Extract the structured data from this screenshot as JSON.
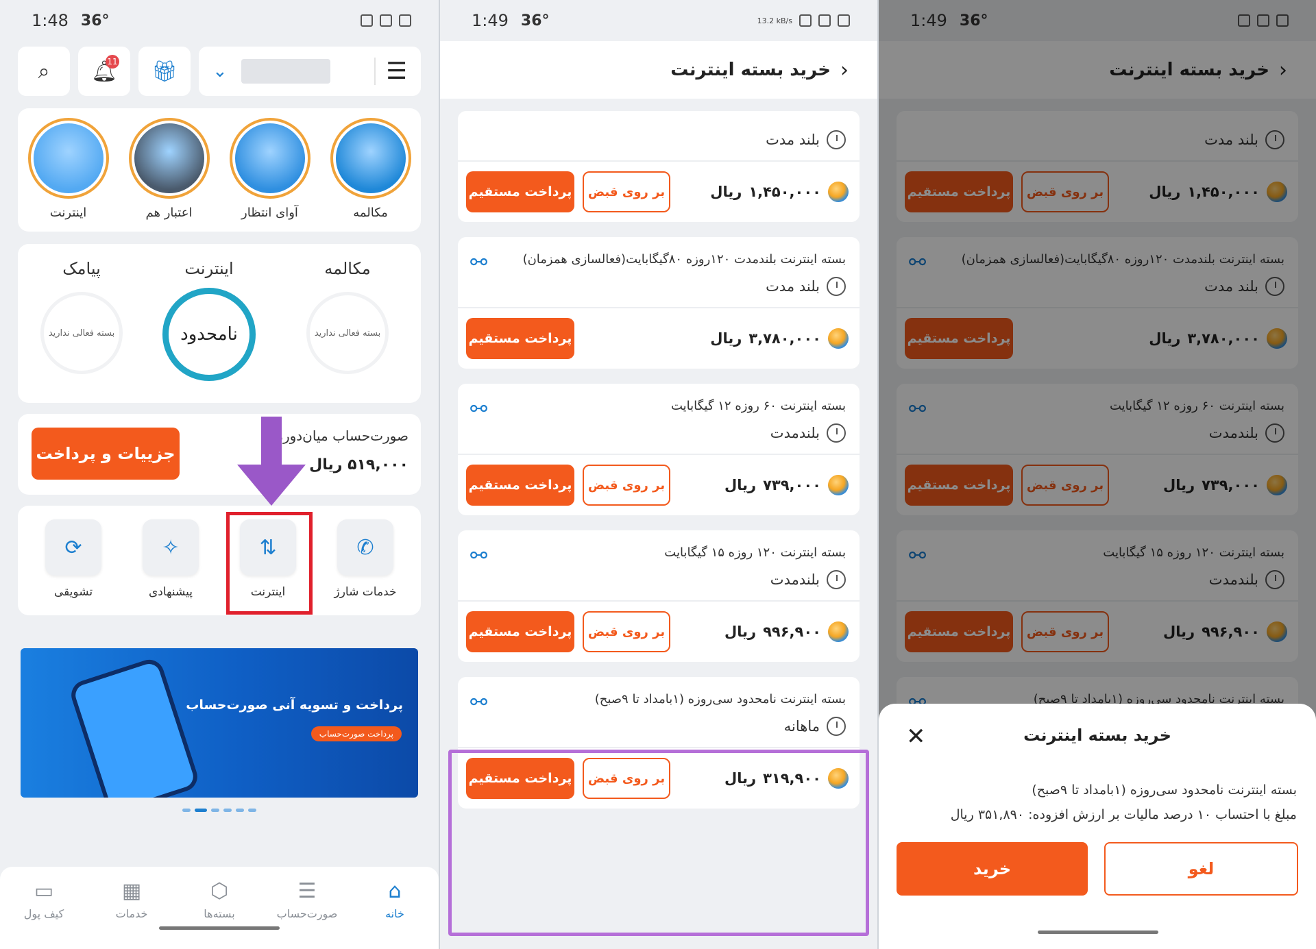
{
  "status": {
    "p1": {
      "time": "1:48",
      "carrier": "36°"
    },
    "p2": {
      "time": "1:49",
      "carrier": "36°",
      "speed": "13.2 kB/s"
    },
    "p3": {
      "time": "1:49",
      "carrier": "36°"
    }
  },
  "home": {
    "notification_count": "11",
    "stories": [
      {
        "label": "مکالمه",
        "color": "#1f88d8"
      },
      {
        "label": "آوای انتظار",
        "color": "#2f8fe0"
      },
      {
        "label": "اعتبار هم",
        "color": "#4a5a6c"
      },
      {
        "label": "اینترنت",
        "color": "#53a9f2"
      }
    ],
    "usage": {
      "call": {
        "title": "مکالمه",
        "status": "بسته فعالی ندارید"
      },
      "internet": {
        "title": "اینترنت",
        "status": "نامحدود"
      },
      "sms": {
        "title": "پیامک",
        "status": "بسته فعالی ندارید"
      }
    },
    "bill": {
      "title": "صورت‌حساب میان‌دوره",
      "amount": "۵۱۹,۰۰۰ ریال",
      "button": "جزییات و پرداخت"
    },
    "services": [
      {
        "label": "خدمات شارژ",
        "icon": "phone-charge-icon"
      },
      {
        "label": "اینترنت",
        "icon": "internet-icon"
      },
      {
        "label": "پیشنهادی",
        "icon": "offer-icon"
      },
      {
        "label": "تشویقی",
        "icon": "reward-icon"
      }
    ],
    "banner": {
      "title": "پرداخت و تسویه آنی صورت‌حساب",
      "chip": "پرداخت صورت‌حساب"
    },
    "nav": [
      {
        "label": "خانه",
        "active": true
      },
      {
        "label": "صورت‌حساب",
        "active": false
      },
      {
        "label": "بسته‌ها",
        "active": false
      },
      {
        "label": "خدمات",
        "active": false
      },
      {
        "label": "کیف پول",
        "active": false
      }
    ]
  },
  "packages_page": {
    "title": "خرید بسته اینترنت",
    "buttons": {
      "direct": "پرداخت مستقیم",
      "bill": "بر روی قبض"
    },
    "packages": [
      {
        "name": "",
        "duration": "بلند مدت",
        "price": "۱,۴۵۰,۰۰۰",
        "currency": "ریال",
        "has_bill": true
      },
      {
        "name": "بسته اینترنت بلندمدت ۱۲۰روزه ۸۰گیگابایت(فعالسازی همزمان)",
        "duration": "بلند مدت",
        "price": "۳,۷۸۰,۰۰۰",
        "currency": "ریال",
        "has_bill": false
      },
      {
        "name": "بسته اینترنت ۶۰ روزه ۱۲ گیگابایت",
        "duration": "بلندمدت",
        "price": "۷۳۹,۰۰۰",
        "currency": "ریال",
        "has_bill": true
      },
      {
        "name": "بسته اینترنت ۱۲۰ روزه ۱۵ گیگابایت",
        "duration": "بلندمدت",
        "price": "۹۹۶,۹۰۰",
        "currency": "ریال",
        "has_bill": true
      },
      {
        "name": "بسته اینترنت نامحدود سی‌روزه (۱بامداد تا ۹صبح)",
        "duration": "ماهانه",
        "price": "۳۱۹,۹۰۰",
        "currency": "ریال",
        "has_bill": true
      }
    ]
  },
  "sheet": {
    "title": "خرید بسته اینترنت",
    "line1": "بسته اینترنت نامحدود سی‌روزه (۱بامداد تا ۹صبح)",
    "line2": "مبلغ با احتساب ۱۰ درصد مالیات بر ارزش افزوده: ۳۵۱,۸۹۰ ریال",
    "buy": "خرید",
    "cancel": "لغو"
  },
  "colors": {
    "accent": "#f35a1d",
    "brand": "#1d7fcf",
    "ring": "#21a5c6",
    "highlight_red": "#e0202c",
    "highlight_purple": "#b56fd8"
  }
}
